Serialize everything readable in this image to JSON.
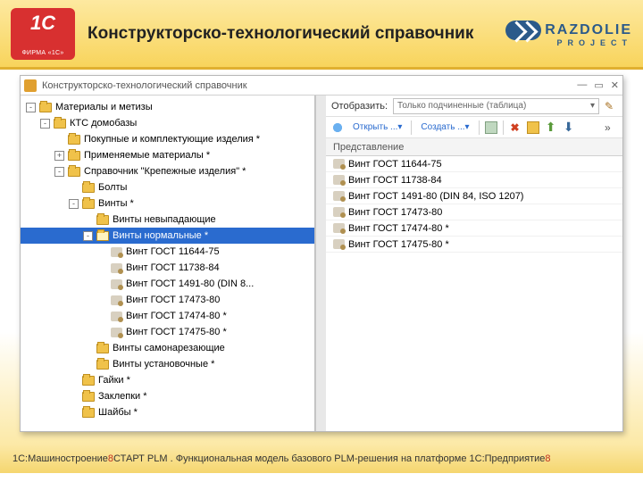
{
  "header": {
    "title": "Конструкторско-технологический справочник",
    "logo_razdolie": "RAZDOLIE",
    "logo_razdolie_sub": "PROJECT"
  },
  "window": {
    "title": "Конструкторско-технологический справочник",
    "tree": [
      {
        "depth": 0,
        "exp": "-",
        "icon": "folder",
        "label": "Материалы и метизы"
      },
      {
        "depth": 1,
        "exp": "-",
        "icon": "folder",
        "label": "КТС домобазы"
      },
      {
        "depth": 2,
        "exp": " ",
        "icon": "folder",
        "label": "Покупные и комплектующие изделия *"
      },
      {
        "depth": 2,
        "exp": "+",
        "icon": "folder",
        "label": "Применяемые материалы *"
      },
      {
        "depth": 2,
        "exp": "-",
        "icon": "folder",
        "label": "Справочник \"Крепежные изделия\" *"
      },
      {
        "depth": 3,
        "exp": " ",
        "icon": "folder",
        "label": "Болты"
      },
      {
        "depth": 3,
        "exp": "-",
        "icon": "folder",
        "label": "Винты *"
      },
      {
        "depth": 4,
        "exp": " ",
        "icon": "folder",
        "label": "Винты невыпадающие"
      },
      {
        "depth": 4,
        "exp": "-",
        "icon": "folder-open",
        "label": "Винты нормальные *",
        "selected": true
      },
      {
        "depth": 5,
        "exp": " ",
        "icon": "item",
        "label": "Винт ГОСТ 11644-75"
      },
      {
        "depth": 5,
        "exp": " ",
        "icon": "item",
        "label": "Винт ГОСТ 11738-84"
      },
      {
        "depth": 5,
        "exp": " ",
        "icon": "item",
        "label": "Винт ГОСТ 1491-80 (DIN 8..."
      },
      {
        "depth": 5,
        "exp": " ",
        "icon": "item",
        "label": "Винт ГОСТ 17473-80"
      },
      {
        "depth": 5,
        "exp": " ",
        "icon": "item",
        "label": "Винт ГОСТ 17474-80 *"
      },
      {
        "depth": 5,
        "exp": " ",
        "icon": "item",
        "label": "Винт ГОСТ 17475-80 *"
      },
      {
        "depth": 4,
        "exp": " ",
        "icon": "folder",
        "label": "Винты самонарезающие"
      },
      {
        "depth": 4,
        "exp": " ",
        "icon": "folder",
        "label": "Винты установочные *"
      },
      {
        "depth": 3,
        "exp": " ",
        "icon": "folder",
        "label": "Гайки *"
      },
      {
        "depth": 3,
        "exp": " ",
        "icon": "folder",
        "label": "Заклепки *"
      },
      {
        "depth": 3,
        "exp": " ",
        "icon": "folder",
        "label": "Шайбы *"
      }
    ],
    "right": {
      "filter_label": "Отобразить:",
      "filter_value": "Только подчиненные (таблица)",
      "toolbar": {
        "open": "Открыть ...",
        "create": "Создать ..."
      },
      "list_header": "Представление",
      "list": [
        "Винт ГОСТ 11644-75",
        "Винт ГОСТ 11738-84",
        "Винт ГОСТ 1491-80 (DIN 84, ISO 1207)",
        "Винт ГОСТ 17473-80",
        "Винт ГОСТ 17474-80 *",
        "Винт ГОСТ 17475-80 *"
      ]
    }
  },
  "footer": {
    "p1": "1С:Машиностроение ",
    "p2": "8",
    "p3": " СТАРТ PLM . Функциональная модель базового PLM-решения на платформе  1С:Предприятие ",
    "p4": "8"
  }
}
